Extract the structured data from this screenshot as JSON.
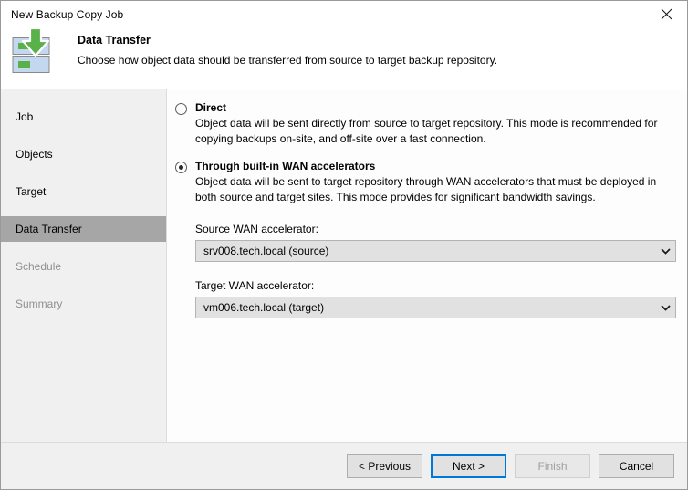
{
  "window": {
    "title": "New Backup Copy Job",
    "close_label": "close-icon"
  },
  "header": {
    "title": "Data Transfer",
    "subtitle": "Choose how object data should be transferred from source to target backup repository.",
    "icon": "backup-repository-download-icon"
  },
  "sidebar": {
    "items": [
      {
        "label": "Job",
        "state": "normal"
      },
      {
        "label": "Objects",
        "state": "normal"
      },
      {
        "label": "Target",
        "state": "normal"
      },
      {
        "label": "Data Transfer",
        "state": "selected"
      },
      {
        "label": "Schedule",
        "state": "disabled"
      },
      {
        "label": "Summary",
        "state": "disabled"
      }
    ]
  },
  "main": {
    "options": [
      {
        "label": "Direct",
        "checked": false,
        "description": "Object data will be sent directly from source to target repository. This mode is recommended for copying backups on-site, and off-site over a fast connection."
      },
      {
        "label": "Through built-in WAN accelerators",
        "checked": true,
        "description": "Object data will be sent to target repository through WAN accelerators that must be deployed in both source and target sites. This mode provides for significant bandwidth savings."
      }
    ],
    "fields": [
      {
        "label": "Source WAN accelerator:",
        "value": "srv008.tech.local (source)"
      },
      {
        "label": "Target WAN accelerator:",
        "value": "vm006.tech.local (target)"
      }
    ]
  },
  "footer": {
    "buttons": [
      {
        "label": "< Previous",
        "state": "normal"
      },
      {
        "label": "Next >",
        "state": "default"
      },
      {
        "label": "Finish",
        "state": "disabled"
      },
      {
        "label": "Cancel",
        "state": "normal"
      }
    ]
  },
  "colors": {
    "accent": "#0078d7",
    "icon_green": "#59b14a",
    "icon_blue": "#c3d8ef",
    "sidebar_bg": "#f0f0f0",
    "selected_bg": "#a6a6a6"
  }
}
